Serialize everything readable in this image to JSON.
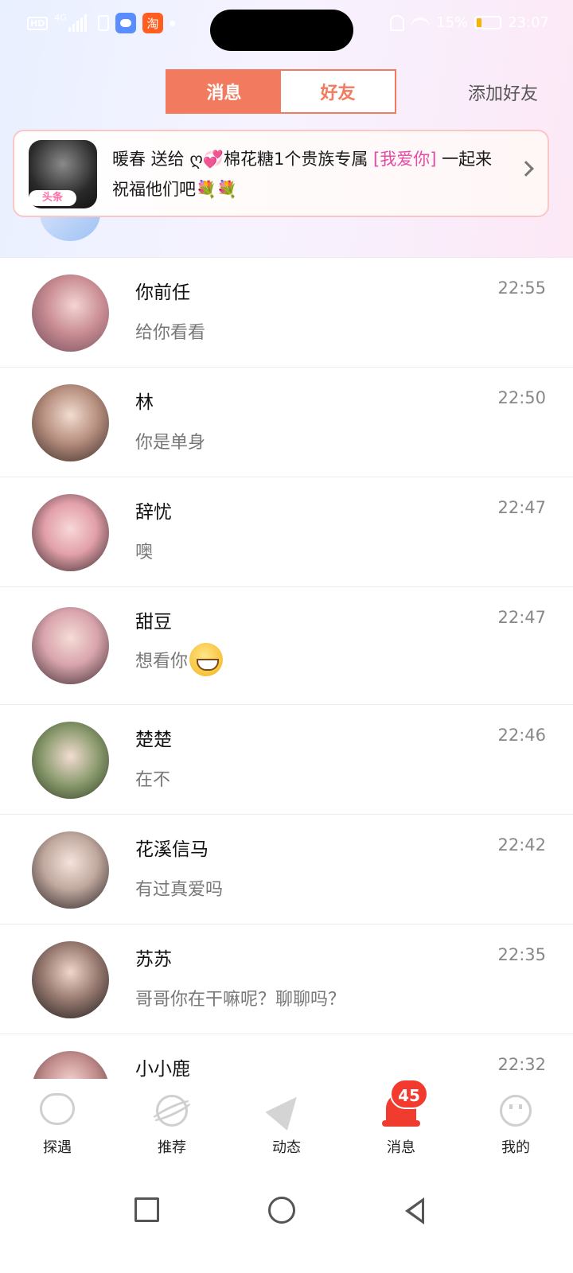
{
  "status_bar": {
    "hd": "HD",
    "network": "4G",
    "app_icon": "淘",
    "battery_percent": "15%",
    "time": "23:07",
    "left_icons": [
      "hd-icon",
      "signal-icon",
      "alert-icon",
      "robot-app-icon",
      "taobao-icon",
      "dot-icon"
    ],
    "right_icons": [
      "mute-icon",
      "wifi-icon",
      "battery-icon"
    ]
  },
  "header": {
    "tab_messages": "消息",
    "tab_friends": "好友",
    "add_friend": "添加好友",
    "accent": "#f27a5e"
  },
  "banner": {
    "avatar_tag": "头条",
    "text_before": "暖春 送给 ღ💞棉花糖1个贵族专属 ",
    "highlight": "[我爱你]",
    "text_after": " 一起来祝福他们吧💐💐",
    "highlight_color": "#e64ba8"
  },
  "conversations": [
    {
      "name": "你前任",
      "time": "22:55",
      "message": "给你看看",
      "emoji": false
    },
    {
      "name": "林",
      "time": "22:50",
      "message": "你是单身",
      "emoji": false
    },
    {
      "name": "辞忧",
      "time": "22:47",
      "message": "噢",
      "emoji": false
    },
    {
      "name": "甜豆",
      "time": "22:47",
      "message": "想看你",
      "emoji": true
    },
    {
      "name": "楚楚",
      "time": "22:46",
      "message": "在不",
      "emoji": false
    },
    {
      "name": "花溪信马",
      "time": "22:42",
      "message": "有过真爱吗",
      "emoji": false
    },
    {
      "name": "苏苏",
      "time": "22:35",
      "message": "哥哥你在干嘛呢？聊聊吗？",
      "emoji": false
    },
    {
      "name": "小小鹿",
      "time": "22:32",
      "message": "",
      "emoji": false
    }
  ],
  "tab_bar": {
    "items": [
      {
        "label": "探遇",
        "icon": "heart-icon"
      },
      {
        "label": "推荐",
        "icon": "planet-icon"
      },
      {
        "label": "动态",
        "icon": "paper-plane-icon"
      },
      {
        "label": "消息",
        "icon": "bell-icon"
      },
      {
        "label": "我的",
        "icon": "face-icon"
      }
    ],
    "badge_count": "45",
    "badge_color": "#f23a2e"
  },
  "system_nav": {
    "icons": [
      "recents-square-icon",
      "home-circle-icon",
      "back-triangle-icon"
    ]
  }
}
